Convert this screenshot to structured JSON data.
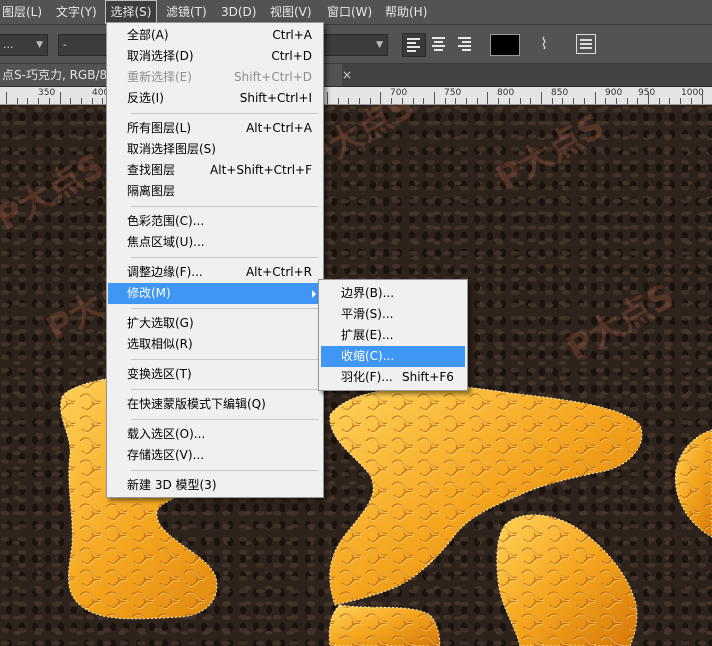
{
  "menubar": {
    "items": [
      {
        "label": "图层(L)"
      },
      {
        "label": "文字(Y)"
      },
      {
        "label": "选择(S)"
      },
      {
        "label": "滤镜(T)"
      },
      {
        "label": "3D(D)"
      },
      {
        "label": "视图(V)"
      },
      {
        "label": "窗口(W)"
      },
      {
        "label": "帮助(H)"
      }
    ]
  },
  "options": {
    "font_style_value": "-",
    "color_hex": "#000000"
  },
  "document": {
    "tab_title": "点S-巧克力, RGB/8",
    "close_glyph": "×"
  },
  "ruler": {
    "labels": [
      "350",
      "400",
      "700",
      "750",
      "800",
      "850",
      "900",
      "950",
      "1000"
    ]
  },
  "watermark_text": "P大点S",
  "select_menu": {
    "items": [
      {
        "label": "全部(A)",
        "shortcut": "Ctrl+A"
      },
      {
        "label": "取消选择(D)",
        "shortcut": "Ctrl+D"
      },
      {
        "label": "重新选择(E)",
        "shortcut": "Shift+Ctrl+D",
        "disabled": true
      },
      {
        "label": "反选(I)",
        "shortcut": "Shift+Ctrl+I"
      },
      {
        "label": "所有图层(L)",
        "shortcut": "Alt+Ctrl+A"
      },
      {
        "label": "取消选择图层(S)",
        "shortcut": ""
      },
      {
        "label": "查找图层",
        "shortcut": "Alt+Shift+Ctrl+F"
      },
      {
        "label": "隔离图层",
        "shortcut": ""
      },
      {
        "label": "色彩范围(C)...",
        "shortcut": ""
      },
      {
        "label": "焦点区域(U)...",
        "shortcut": ""
      },
      {
        "label": "调整边缘(F)...",
        "shortcut": "Alt+Ctrl+R"
      },
      {
        "label": "修改(M)",
        "shortcut": "",
        "highlighted": true
      },
      {
        "label": "扩大选取(G)",
        "shortcut": ""
      },
      {
        "label": "选取相似(R)",
        "shortcut": ""
      },
      {
        "label": "变换选区(T)",
        "shortcut": ""
      },
      {
        "label": "在快速蒙版模式下编辑(Q)",
        "shortcut": ""
      },
      {
        "label": "载入选区(O)...",
        "shortcut": ""
      },
      {
        "label": "存储选区(V)...",
        "shortcut": ""
      },
      {
        "label": "新建 3D 模型(3)",
        "shortcut": ""
      }
    ]
  },
  "modify_submenu": {
    "items": [
      {
        "label": "边界(B)...",
        "shortcut": ""
      },
      {
        "label": "平滑(S)...",
        "shortcut": ""
      },
      {
        "label": "扩展(E)...",
        "shortcut": ""
      },
      {
        "label": "收缩(C)...",
        "shortcut": "",
        "highlighted": true
      },
      {
        "label": "羽化(F)...",
        "shortcut": "Shift+F6"
      }
    ]
  },
  "colors": {
    "highlight": "#3f96f3",
    "menu_bg": "#f0f0f0",
    "chrome_bg": "#535353",
    "canvas_bg": "#2e231c",
    "candy_gold": "#f2a51c"
  }
}
